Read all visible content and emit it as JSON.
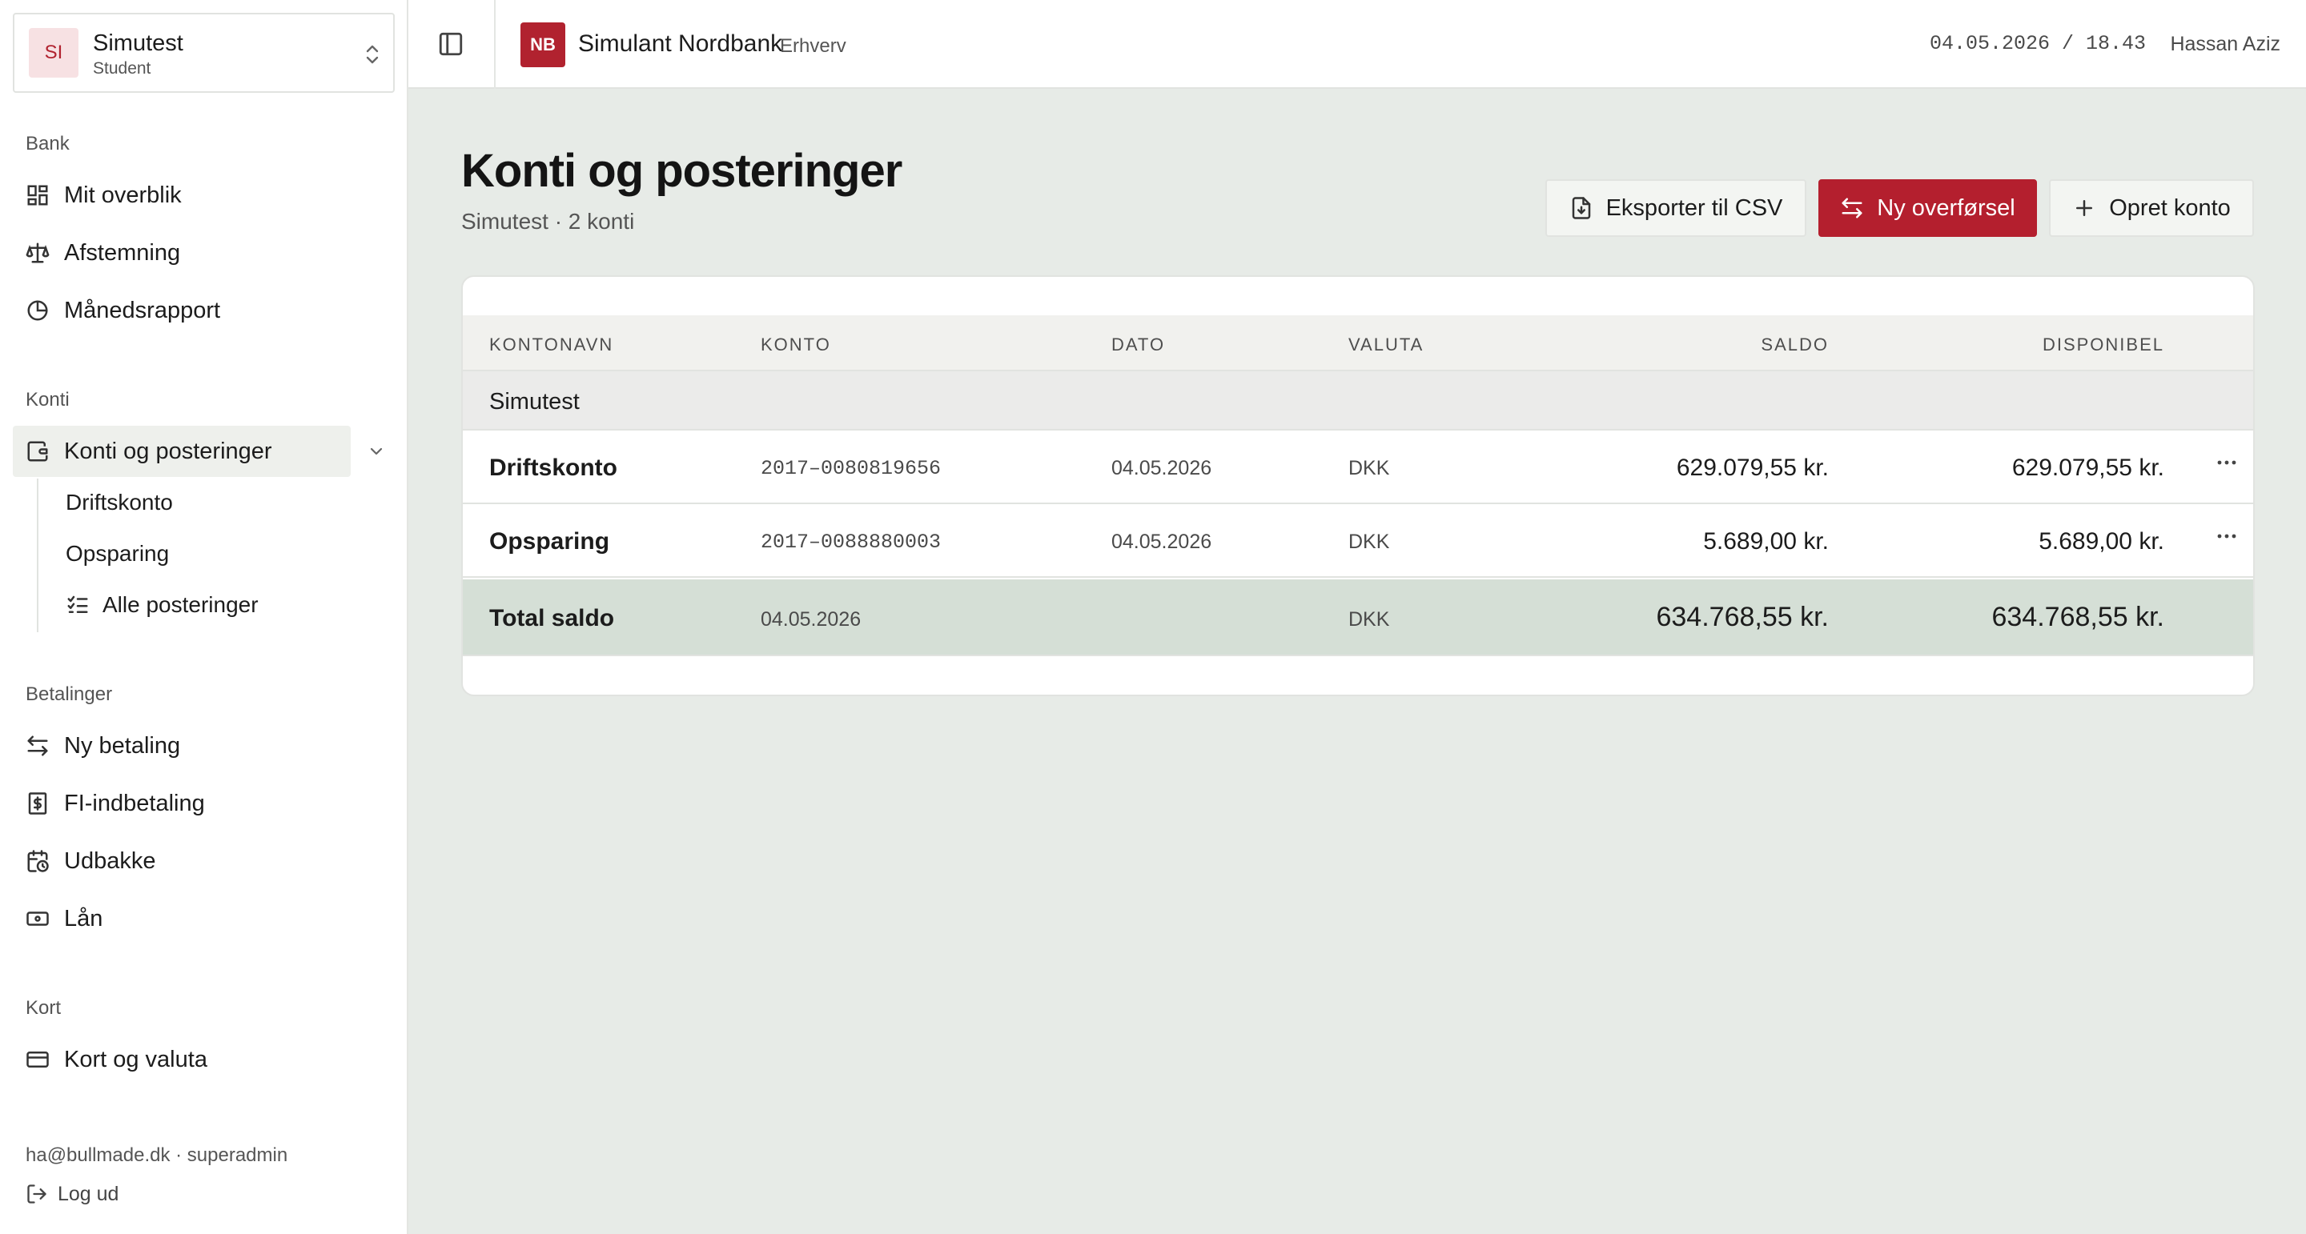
{
  "org": {
    "initials": "SI",
    "name": "Simutest",
    "role": "Student"
  },
  "sidebar": {
    "sections": {
      "bank": "Bank",
      "konti": "Konti",
      "betalinger": "Betalinger",
      "kort": "Kort"
    },
    "bank_items": [
      {
        "label": "Mit overblik",
        "icon": "grid-icon"
      },
      {
        "label": "Afstemning",
        "icon": "scale-icon"
      },
      {
        "label": "Månedsrapport",
        "icon": "pie-chart-icon"
      }
    ],
    "konti_items": [
      {
        "label": "Konti og posteringer",
        "icon": "wallet-icon",
        "active": true
      }
    ],
    "konti_sub": [
      {
        "label": "Driftskonto"
      },
      {
        "label": "Opsparing"
      },
      {
        "label": "Alle posteringer",
        "icon": "list-checks-icon"
      }
    ],
    "betalinger_items": [
      {
        "label": "Ny betaling",
        "icon": "arrows-swap-icon"
      },
      {
        "label": "FI-indbetaling",
        "icon": "receipt-dollar-icon"
      },
      {
        "label": "Udbakke",
        "icon": "calendar-clock-icon"
      },
      {
        "label": "Lån",
        "icon": "banknote-icon"
      }
    ],
    "kort_items": [
      {
        "label": "Kort og valuta",
        "icon": "credit-card-icon"
      }
    ],
    "footer": {
      "email": "ha@bullmade.dk · superadmin",
      "logout": "Log ud"
    }
  },
  "topbar": {
    "bank_initials": "NB",
    "bank_name": "Simulant Nordbank",
    "bank_type": "Erhverv",
    "datetime": "04.05.2026 / 18.43",
    "user": "Hassan Aziz"
  },
  "main": {
    "title": "Konti og posteringer",
    "subtitle": "Simutest · 2 konti",
    "buttons": {
      "export": "Eksporter til CSV",
      "transfer": "Ny overførsel",
      "create": "Opret konto"
    },
    "colors": {
      "accent": "#b41f2e",
      "total_row": "#d5dfd6"
    }
  },
  "table": {
    "headers": [
      "KONTONAVN",
      "KONTO",
      "DATO",
      "VALUTA",
      "SALDO",
      "DISPONIBEL"
    ],
    "group": "Simutest",
    "rows": [
      {
        "name": "Driftskonto",
        "account": "2017–0080819656",
        "date": "04.05.2026",
        "currency": "DKK",
        "saldo": "629.079,55 kr.",
        "disponibel": "629.079,55 kr."
      },
      {
        "name": "Opsparing",
        "account": "2017–0088880003",
        "date": "04.05.2026",
        "currency": "DKK",
        "saldo": "5.689,00 kr.",
        "disponibel": "5.689,00 kr."
      }
    ],
    "total": {
      "name": "Total saldo",
      "date": "04.05.2026",
      "currency": "DKK",
      "saldo": "634.768,55 kr.",
      "disponibel": "634.768,55 kr."
    }
  }
}
